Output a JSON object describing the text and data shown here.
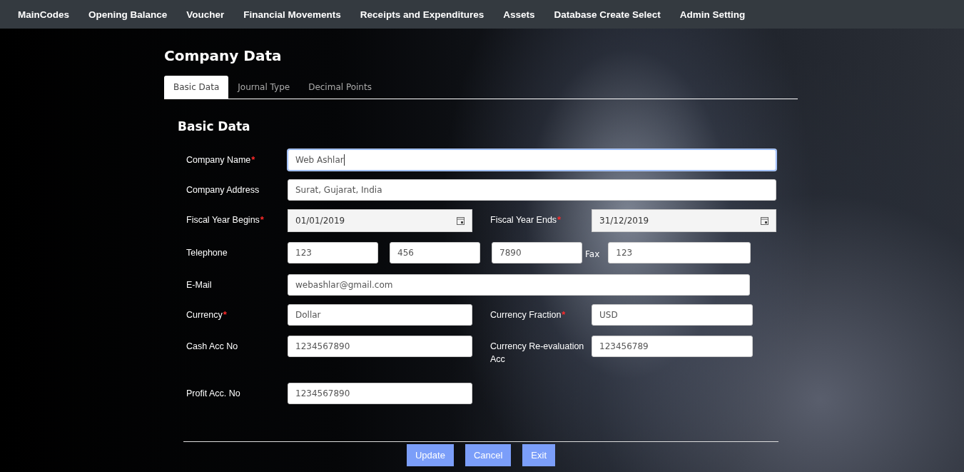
{
  "nav": {
    "items": [
      "MainCodes",
      "Opening Balance",
      "Voucher",
      "Financial Movements",
      "Receipts and Expenditures",
      "Assets",
      "Database Create Select",
      "Admin Setting"
    ]
  },
  "page_title": "Company Data",
  "tabs": [
    {
      "label": "Basic Data",
      "selected": true
    },
    {
      "label": "Journal Type",
      "selected": false
    },
    {
      "label": "Decimal Points",
      "selected": false
    }
  ],
  "section_title": "Basic Data",
  "required_mark": "*",
  "rows": [
    {
      "kind": "wide",
      "label": "Company Name",
      "required": true,
      "value": "Web Ashlar",
      "focused": true
    },
    {
      "kind": "wide",
      "label": "Company Address",
      "required": false,
      "value": "Surat, Gujarat, India",
      "focused": false
    },
    {
      "kind": "pair",
      "fields": [
        {
          "label": "Fiscal Year Begins",
          "required": true,
          "value": "01/01/2019",
          "kind": "date"
        },
        {
          "label": "Fiscal Year Ends",
          "required": true,
          "value": "31/12/2019",
          "kind": "date"
        }
      ]
    },
    {
      "kind": "phone",
      "label": "Telephone",
      "parts": [
        "123",
        "456",
        "7890"
      ],
      "fax_label": "Fax",
      "fax_value": "123"
    },
    {
      "kind": "medium",
      "label": "E-Mail",
      "required": false,
      "value": "webashlar@gmail.com",
      "focused": false
    },
    {
      "kind": "pair",
      "fields": [
        {
          "label": "Currency",
          "required": true,
          "value": "Dollar",
          "kind": "text"
        },
        {
          "label": "Currency Fraction",
          "required": true,
          "value": "USD",
          "kind": "text"
        }
      ]
    },
    {
      "kind": "pair",
      "fields": [
        {
          "label": "Cash Acc No",
          "required": false,
          "value": "1234567890",
          "kind": "text"
        },
        {
          "label": "Currency Re-evaluation Acc",
          "required": false,
          "value": "123456789",
          "kind": "text"
        }
      ]
    },
    {
      "kind": "pair",
      "fields": [
        {
          "label": "Profit Acc. No",
          "required": false,
          "value": "1234567890",
          "kind": "text"
        }
      ]
    }
  ],
  "buttons": [
    "Update",
    "Cancel",
    "Exit"
  ]
}
